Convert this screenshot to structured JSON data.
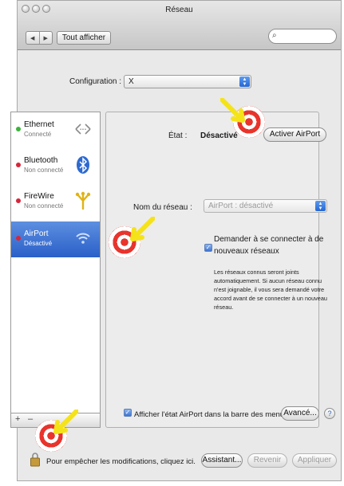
{
  "window": {
    "title": "Réseau"
  },
  "toolbar": {
    "back": "◀",
    "forward": "▶",
    "show_all": "Tout afficher",
    "search_icon": "search-icon"
  },
  "configuration": {
    "label": "Configuration :",
    "value": "X"
  },
  "services": [
    {
      "name": "Ethernet",
      "status": "Connecté",
      "dot_color": "#3cb43c",
      "icon": "ethernet-icon"
    },
    {
      "name": "Bluetooth",
      "status": "Non connecté",
      "dot_color": "#d6263a",
      "icon": "bluetooth-icon"
    },
    {
      "name": "FireWire",
      "status": "Non connecté",
      "dot_color": "#d6263a",
      "icon": "firewire-icon"
    },
    {
      "name": "AirPort",
      "status": "Désactivé",
      "dot_color": "#d6263a",
      "icon": "wifi-icon",
      "selected": true
    }
  ],
  "list_footer": {
    "add": "+",
    "remove": "–"
  },
  "panel": {
    "state_label": "État :",
    "state_value": "Désactivé",
    "activate_button": "Activer AirPort",
    "network_name_label": "Nom du réseau :",
    "network_name_value": "AirPort : désactivé",
    "ask_checkbox_label": "Demander à se connecter à de nouveaux réseaux",
    "ask_help_text": "Les réseaux connus seront joints automatiquement. Si aucun réseau connu n'est joignable, il vous sera demandé votre accord avant de se connecter à un nouveau réseau.",
    "show_status_label": "Afficher l'état AirPort dans la barre des menus",
    "advanced_button": "Avancé...",
    "help_button": "?"
  },
  "bottom": {
    "lock_text": "Pour empêcher les modifications, cliquez ici.",
    "assistant_button": "Assistant...",
    "revert_button": "Revenir",
    "apply_button": "Appliquer"
  },
  "colors": {
    "selection": "#2a5fc8",
    "target_red": "#e8342c",
    "arrow_yellow": "#f5e31a"
  }
}
